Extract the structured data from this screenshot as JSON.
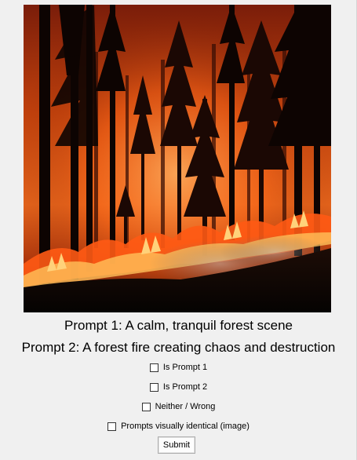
{
  "image": {
    "icon": "forest-fire-image"
  },
  "prompts": {
    "prompt1": "Prompt 1: A calm, tranquil forest scene",
    "prompt2": "Prompt 2: A forest fire creating chaos and destruction"
  },
  "options": [
    {
      "label": "Is Prompt 1",
      "checked": false
    },
    {
      "label": "Is Prompt 2",
      "checked": false
    },
    {
      "label": "Neither / Wrong",
      "checked": false
    },
    {
      "label": "Prompts visually identical (image)",
      "checked": false
    }
  ],
  "submit_label": "Submit",
  "colors": {
    "background": "#f0f0f0",
    "fire_orange": "#ff5a14",
    "sky_glow": "#c2410c"
  }
}
